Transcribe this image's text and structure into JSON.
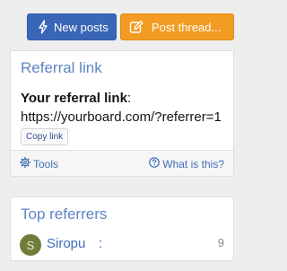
{
  "header_buttons": {
    "new_posts": {
      "label": "New posts",
      "icon": "bolt-icon",
      "color": "#3a66b7"
    },
    "post_thread": {
      "label": "Post thread...",
      "icon": "edit-icon",
      "color": "#f29c24"
    }
  },
  "referral_block": {
    "title": "Referral link",
    "label": "Your referral link",
    "label_suffix": ":",
    "url": "https://yourboard.com/?referrer=1",
    "copy_label": "Copy link",
    "footer": {
      "tools_label": "Tools",
      "tools_icon": "gear-icon",
      "help_label": "What is this?",
      "help_icon": "question-circle-icon"
    }
  },
  "top_referrers_block": {
    "title": "Top referrers",
    "rows": [
      {
        "avatar_letter": "S",
        "name": "Siropu",
        "separator": ":",
        "count": "9",
        "avatar_color": "#6f7d3a"
      }
    ]
  }
}
